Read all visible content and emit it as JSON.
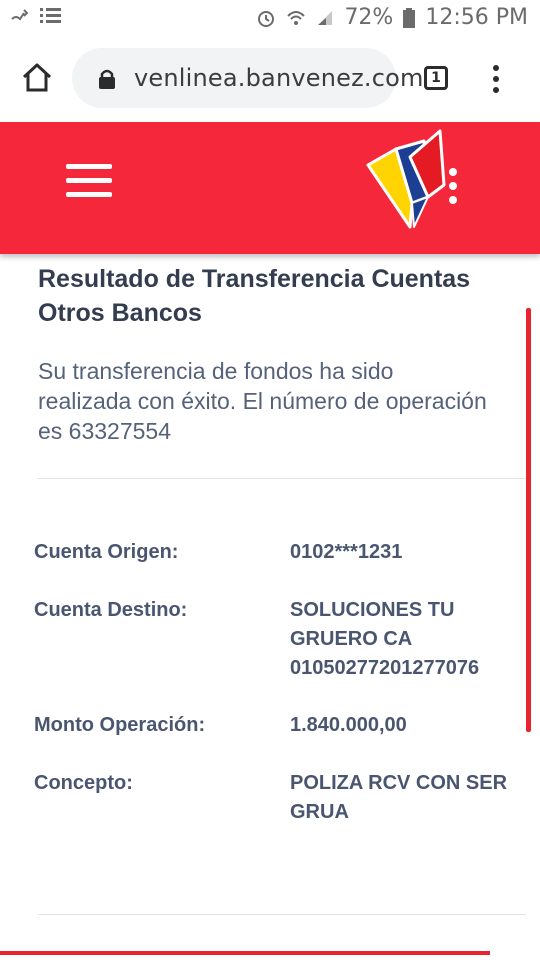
{
  "status_bar": {
    "battery": "72%",
    "time": "12:56 PM"
  },
  "browser": {
    "url": "venlinea.banvenez.com",
    "tab_count": "1"
  },
  "page": {
    "title": "Resultado de Transferencia Cuentas Otros Bancos",
    "message": "Su transferencia de fondos ha sido realizada con éxito. El número de operación es 63327554",
    "details": [
      {
        "label": "Cuenta Origen:",
        "value": "0102***1231"
      },
      {
        "label": "Cuenta Destino:",
        "value": "SOLUCIONES TU\nGRUERO CA\n01050277201277076"
      },
      {
        "label": "Monto Operación:",
        "value": "1.840.000,00"
      },
      {
        "label": "Concepto:",
        "value": "POLIZA RCV CON SER\nGRUA"
      }
    ]
  },
  "colors": {
    "header_red": "#f4283a",
    "text_dark": "#333d4f",
    "text_label": "#4a5670"
  }
}
